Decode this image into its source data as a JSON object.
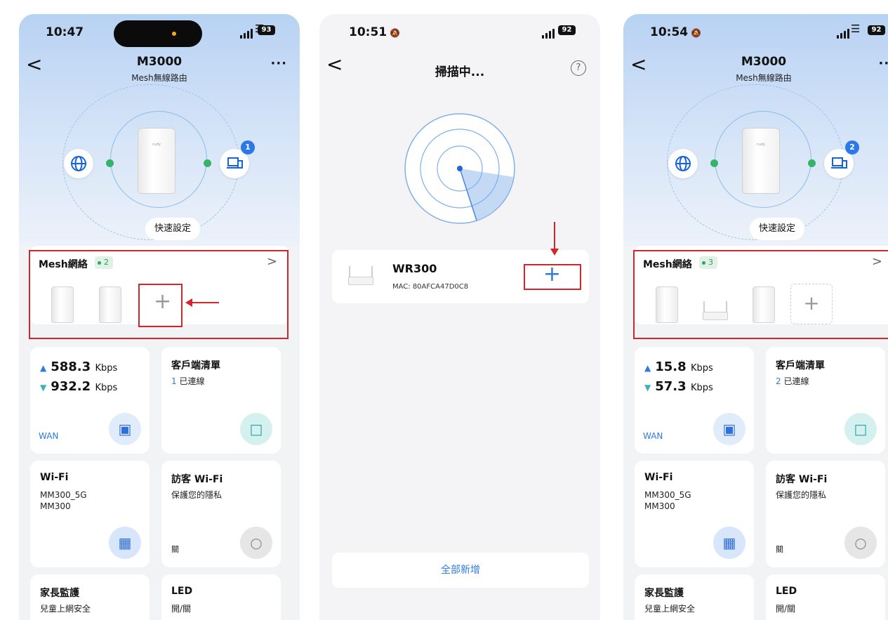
{
  "screens": [
    {
      "status": {
        "time": "10:47",
        "battery": "93"
      },
      "header": {
        "title": "M3000",
        "subtitle": "Mesh無線路由",
        "more": "···"
      },
      "topology": {
        "client_badge": "1",
        "quick_setup": "快速設定"
      },
      "mesh": {
        "title": "Mesh網絡",
        "count": "2",
        "add_label": "+"
      },
      "speed": {
        "up_value": "588.3",
        "down_value": "932.2",
        "unit": "Kbps",
        "wan_label": "WAN"
      },
      "clients": {
        "title": "客戶端清單",
        "count": "1",
        "connected_label": "已連線"
      },
      "wifi": {
        "title": "Wi-Fi",
        "ssid_5g": "MM300_5G",
        "ssid": "MM300"
      },
      "guest": {
        "title": "訪客 Wi-Fi",
        "subtitle": "保護您的隱私",
        "state": "關"
      },
      "parental": {
        "title": "家長監護",
        "subtitle": "兒童上網安全"
      },
      "led": {
        "title": "LED",
        "subtitle": "開/關"
      }
    },
    {
      "status": {
        "time": "10:51",
        "battery": "92"
      },
      "header": {
        "title": "掃描中...",
        "help": "?"
      },
      "device": {
        "name": "WR300",
        "mac": "MAC: 80AFCA47D0C8",
        "add_label": "+"
      },
      "add_all": "全部新增"
    },
    {
      "status": {
        "time": "10:54",
        "battery": "92"
      },
      "header": {
        "title": "M3000",
        "subtitle": "Mesh無線路由",
        "more": "···"
      },
      "topology": {
        "client_badge": "2",
        "quick_setup": "快速設定"
      },
      "mesh": {
        "title": "Mesh網絡",
        "count": "3",
        "add_label": "+"
      },
      "speed": {
        "up_value": "15.8",
        "down_value": "57.3",
        "unit": "Kbps",
        "wan_label": "WAN"
      },
      "clients": {
        "title": "客戶端清單",
        "count": "2",
        "connected_label": "已連線"
      },
      "wifi": {
        "title": "Wi-Fi",
        "ssid_5g": "MM300_5G",
        "ssid": "MM300"
      },
      "guest": {
        "title": "訪客 Wi-Fi",
        "subtitle": "保護您的隱私",
        "state": "關"
      },
      "parental": {
        "title": "家長監護",
        "subtitle": "兒童上網安全"
      },
      "led": {
        "title": "LED",
        "subtitle": "開/關"
      }
    }
  ],
  "icons": {
    "back": "<",
    "chevron": ">",
    "globe": "globe-icon",
    "client": "laptop-icon"
  },
  "colors": {
    "accent": "#2f7bde",
    "online": "#35b36a",
    "annotation": "#d1262b",
    "teal": "#3ab2b3"
  }
}
